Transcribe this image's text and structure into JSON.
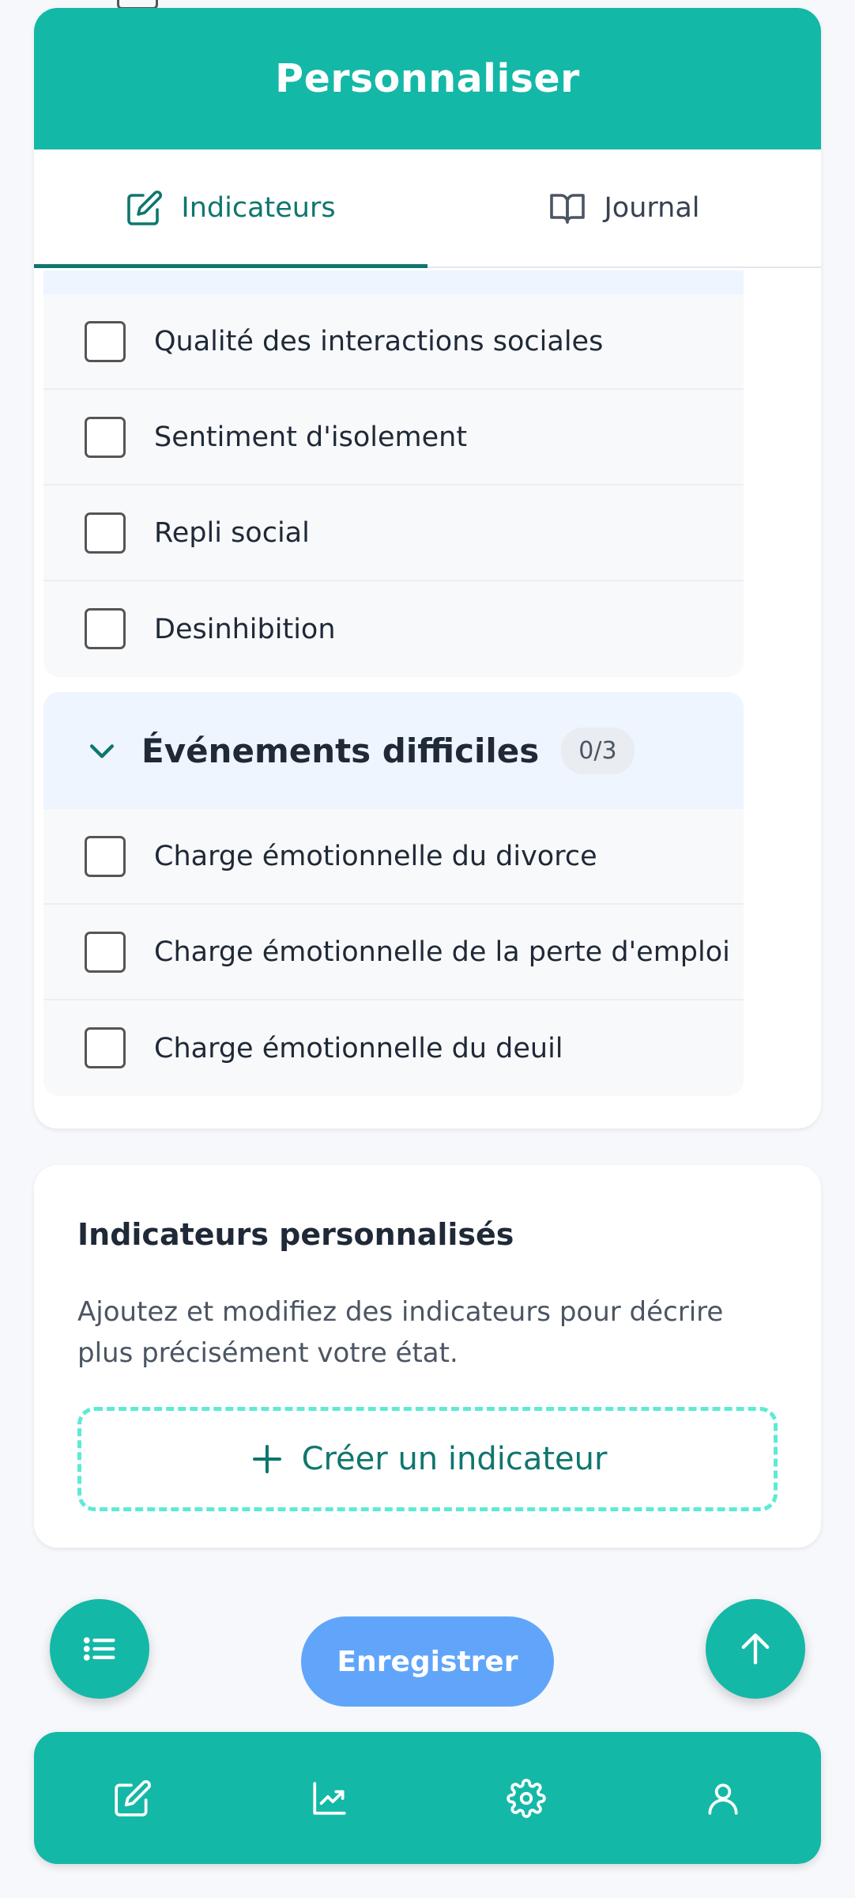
{
  "header": {
    "title": "Personnaliser"
  },
  "tabs": [
    {
      "label": "Indicateurs",
      "icon": "edit-icon",
      "active": true
    },
    {
      "label": "Journal",
      "icon": "book-icon",
      "active": false
    }
  ],
  "social_group": {
    "items": [
      {
        "label": "Qualité des interactions sociales",
        "checked": false
      },
      {
        "label": "Sentiment d'isolement",
        "checked": false
      },
      {
        "label": "Repli social",
        "checked": false
      },
      {
        "label": "Desinhibition",
        "checked": false
      }
    ]
  },
  "events_group": {
    "title": "Événements difficiles",
    "count": "0/3",
    "items": [
      {
        "label": "Charge émotionnelle du divorce",
        "checked": false
      },
      {
        "label": "Charge émotionnelle de la perte d'emploi",
        "checked": false
      },
      {
        "label": "Charge émotionnelle du deuil",
        "checked": false
      }
    ]
  },
  "custom": {
    "title": "Indicateurs personnalisés",
    "description": "Ajoutez et modifiez des indicateurs pour décrire plus précisément votre état.",
    "create_label": "Créer un indicateur"
  },
  "actions": {
    "save_label": "Enregistrer"
  },
  "bottom_nav": [
    "edit-icon",
    "chart-icon",
    "settings-icon",
    "user-icon"
  ],
  "colors": {
    "primary": "#14b8a6",
    "primary_dark": "#0f766e",
    "save": "#60a5fa",
    "group_header": "#eef5ff"
  }
}
